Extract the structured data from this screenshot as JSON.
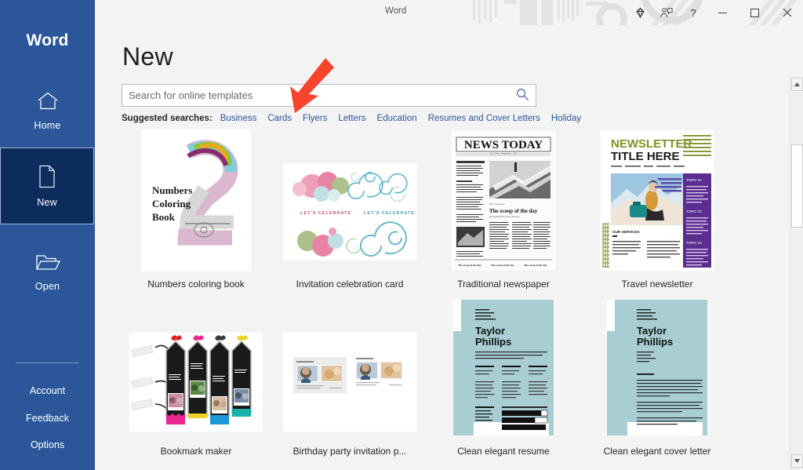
{
  "app": {
    "name": "Word",
    "titlebar_title": "Word"
  },
  "titlebar": {
    "icons": [
      {
        "name": "premium-diamond-icon",
        "label": "Premium"
      },
      {
        "name": "account-person-icon",
        "label": "Account"
      },
      {
        "name": "help-icon",
        "label": "?"
      }
    ],
    "window_controls": [
      {
        "name": "minimize-button",
        "glyph": "─"
      },
      {
        "name": "maximize-button",
        "glyph": "□"
      },
      {
        "name": "close-button",
        "glyph": "✕"
      }
    ]
  },
  "sidebar": {
    "brand": "Word",
    "items": [
      {
        "label": "Home",
        "icon": "home-icon",
        "selected": false
      },
      {
        "label": "New",
        "icon": "new-document-icon",
        "selected": true
      },
      {
        "label": "Open",
        "icon": "open-folder-icon",
        "selected": false
      }
    ],
    "links": [
      {
        "label": "Account"
      },
      {
        "label": "Feedback"
      },
      {
        "label": "Options"
      }
    ],
    "background_color": "#2b579a",
    "selected_color": "#0d2c5e"
  },
  "main": {
    "page_title": "New",
    "search": {
      "placeholder": "Search for online templates",
      "value": "",
      "icon": "search-icon",
      "icon_color": "#4a5ba8"
    },
    "suggested": {
      "label": "Suggested searches:",
      "links": [
        "Business",
        "Cards",
        "Flyers",
        "Letters",
        "Education",
        "Resumes and Cover Letters",
        "Holiday"
      ],
      "link_color": "#2b579a"
    },
    "templates": [
      {
        "caption": "Numbers coloring book",
        "thumb": "numbers-coloring-book"
      },
      {
        "caption": "Invitation celebration card",
        "thumb": "invitation-celebration-card"
      },
      {
        "caption": "Traditional newspaper",
        "thumb": "traditional-newspaper"
      },
      {
        "caption": "Travel newsletter",
        "thumb": "travel-newsletter"
      },
      {
        "caption": "Bookmark maker",
        "thumb": "bookmark-maker"
      },
      {
        "caption": "Birthday party invitation p...",
        "thumb": "birthday-party-invitation"
      },
      {
        "caption": "Clean elegant resume",
        "thumb": "clean-elegant-resume"
      },
      {
        "caption": "Clean elegant cover letter",
        "thumb": "clean-elegant-cover-letter"
      }
    ],
    "thumbnail_text": {
      "numbers_coloring_book": [
        "Numbers",
        "Coloring",
        "Book"
      ],
      "invitation_card": [
        "LET'S CELEBRATE",
        "LET'S CELEBRATE"
      ],
      "newspaper": {
        "masthead": "NEWS TODAY",
        "headline": "The scoop of the day"
      },
      "travel_newsletter": {
        "title_line1": "NEWSLETTER",
        "title_line2": "TITLE HERE",
        "section": "OUR SERVICES",
        "topics": [
          "TOPIC 01",
          "TOPIC 02",
          "TOPIC 03"
        ]
      },
      "resume_name": [
        "Taylor",
        "Phillips"
      ],
      "cover_letter_name": [
        "Taylor",
        "Phillips"
      ]
    }
  },
  "scrollbar": {
    "up_arrow": "▲",
    "down_arrow": "▼",
    "thumb_position_pct": 18
  },
  "annotation": {
    "type": "red-arrow",
    "points_at": "Flyers",
    "color": "#f8432d"
  }
}
